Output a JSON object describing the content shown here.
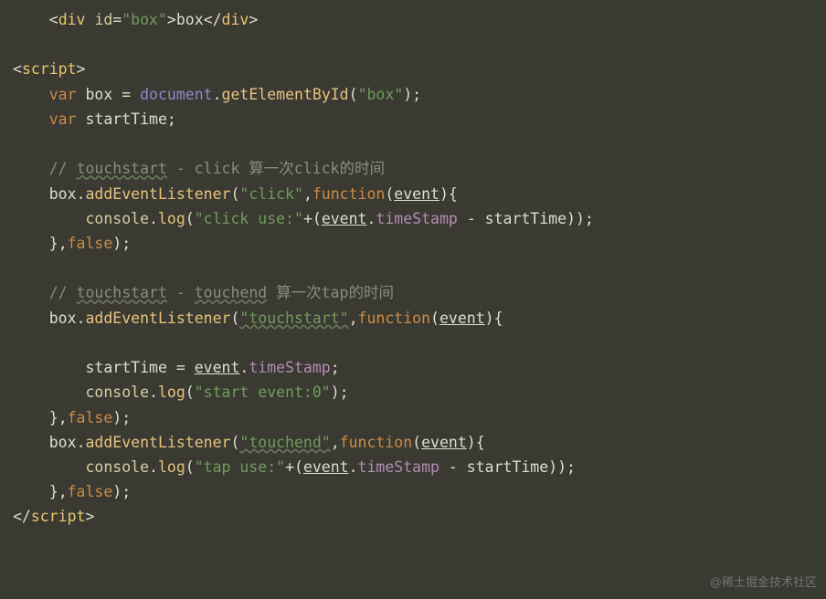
{
  "code": {
    "l1": {
      "tag": "div",
      "attr": "id",
      "val": "\"box\"",
      "text": "box"
    },
    "l2": {
      "tag": "script"
    },
    "l3": {
      "kw": "var",
      "name": "box",
      "obj": "document",
      "method": "getElementById",
      "arg": "\"box\""
    },
    "l4": {
      "kw": "var",
      "name": "startTime"
    },
    "c1": {
      "prefix": "// ",
      "word1": "touchstart",
      "mid": " - click 算一次click的时间"
    },
    "l5": {
      "obj": "box",
      "method": "addEventListener",
      "arg1": "\"click\"",
      "fn": "function",
      "param": "event"
    },
    "l6": {
      "obj": "console",
      "method": "log",
      "str": "\"click use:\"",
      "op": "+",
      "paramRef": "event",
      "prop": "timeStamp",
      "minus": " - ",
      "rhs": "startTime"
    },
    "l7": {
      "close": "}",
      "arg2": "false"
    },
    "c2": {
      "prefix": "// ",
      "word1": "touchstart",
      "mid": " - ",
      "word2": "touchend",
      "rest": " 算一次tap的时间"
    },
    "l8": {
      "obj": "box",
      "method": "addEventListener",
      "arg1": "\"touchstart\"",
      "fn": "function",
      "param": "event"
    },
    "l9": {
      "lhs": "startTime",
      "eq": " = ",
      "paramRef": "event",
      "prop": "timeStamp"
    },
    "l10": {
      "obj": "console",
      "method": "log",
      "arg": "\"start event:0\""
    },
    "l11": {
      "close": "}",
      "arg2": "false"
    },
    "l12": {
      "obj": "box",
      "method": "addEventListener",
      "arg1": "\"touchend\"",
      "fn": "function",
      "param": "event"
    },
    "l13": {
      "obj": "console",
      "method": "log",
      "str": "\"tap use:\"",
      "op": "+",
      "paramRef": "event",
      "prop": "timeStamp",
      "minus": " - ",
      "rhs": "startTime"
    },
    "l14": {
      "close": "}",
      "arg2": "false"
    },
    "l15": {
      "tag": "script"
    }
  },
  "watermark": "@稀土掘金技术社区"
}
